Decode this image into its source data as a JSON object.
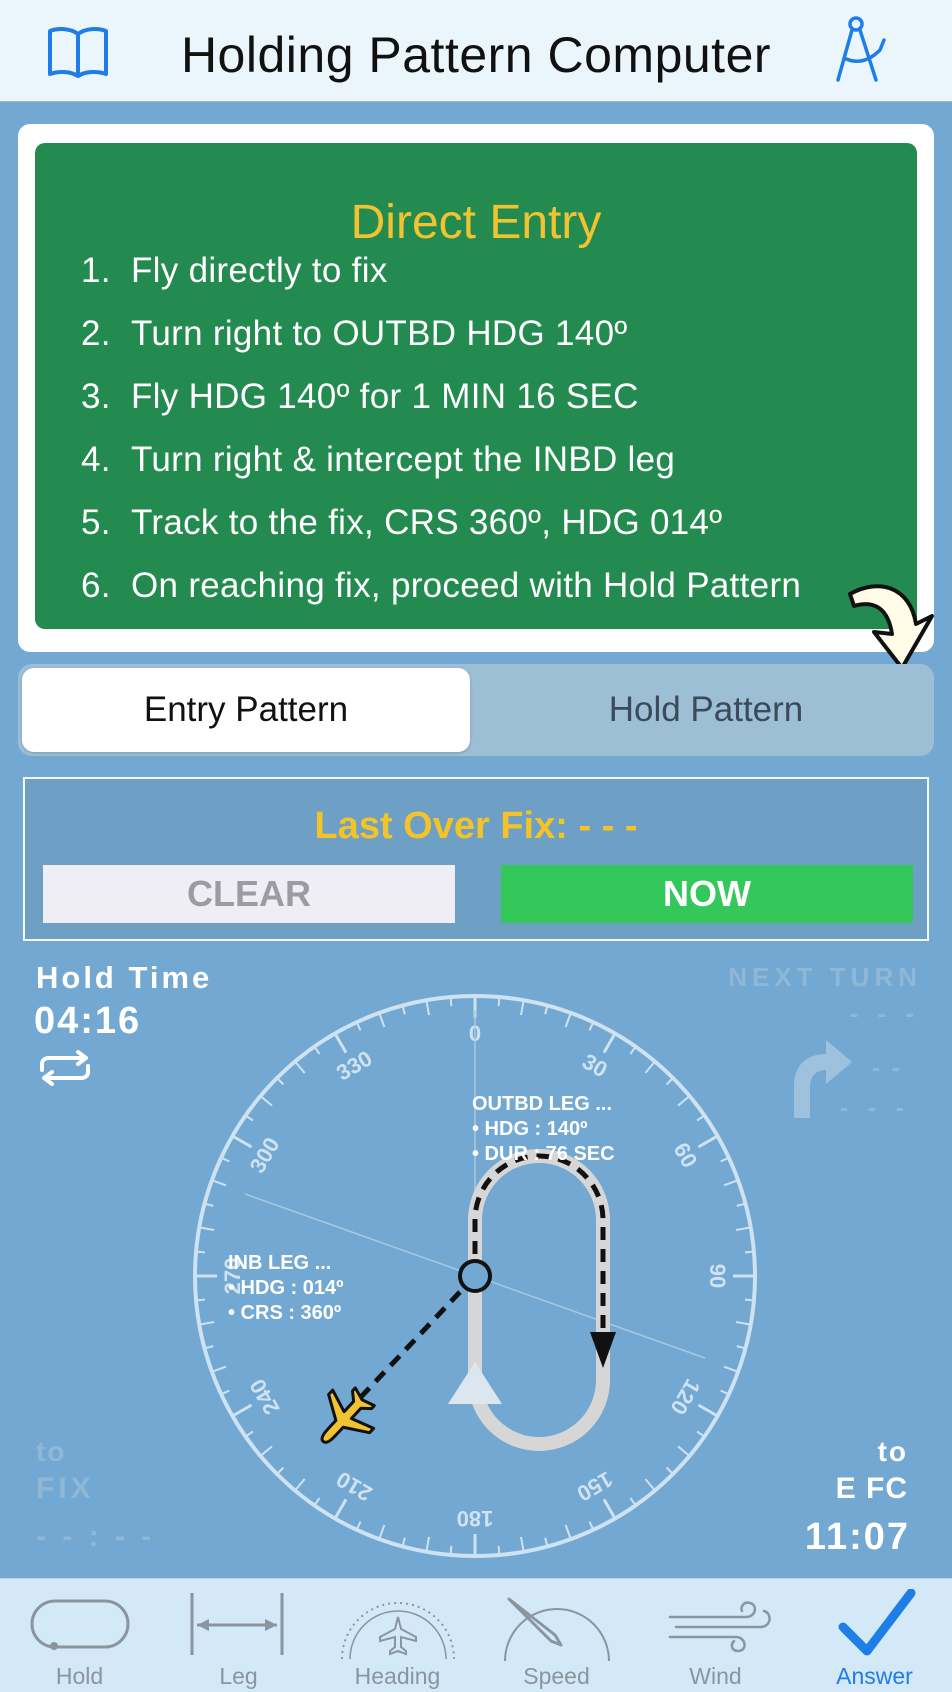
{
  "header": {
    "title": "Holding Pattern Computer",
    "left_icon": "book-icon",
    "right_icon": "compass-icon"
  },
  "instructions": {
    "heading": "Direct Entry",
    "steps": [
      {
        "n": "1.",
        "text": "Fly directly to fix"
      },
      {
        "n": "2.",
        "text": "Turn right to OUTBD HDG 140º"
      },
      {
        "n": "3.",
        "text": "Fly HDG 140º for 1 MIN 16 SEC"
      },
      {
        "n": "4.",
        "text": "Turn right & intercept the INBD leg"
      },
      {
        "n": "5.",
        "text": "Track to the fix, CRS 360º, HDG 014º"
      },
      {
        "n": "6.",
        "text": "On reaching fix, proceed with Hold Pattern"
      }
    ]
  },
  "segment": {
    "options": [
      "Entry Pattern",
      "Hold Pattern"
    ],
    "selected": "Entry Pattern"
  },
  "fix": {
    "label": "Last Over Fix:  - - -",
    "clear_label": "CLEAR",
    "now_label": "NOW"
  },
  "hold_time": {
    "label": "Hold  Time",
    "value": "04:16"
  },
  "next_turn": {
    "label": "NEXT TURN",
    "dash1": "- - -",
    "dash2": "- -",
    "dash3": "- - -"
  },
  "to_fix": {
    "to": "to",
    "label": "FIX",
    "value": "- - : - -"
  },
  "efc": {
    "to": "to",
    "label": "E FC",
    "value": "11:07"
  },
  "dial": {
    "ticks": [
      "0",
      "30",
      "60",
      "90",
      "120",
      "150",
      "180",
      "210",
      "240",
      "270",
      "300",
      "330"
    ],
    "outbound": {
      "title": "OUTBD LEG ...",
      "hdg": "• HDG : 140º",
      "dur": "• DUR : 76 SEC"
    },
    "inbound": {
      "title": "INB LEG ...",
      "hdg": "• HDG : 014º",
      "crs": "• CRS  : 360º"
    }
  },
  "colors": {
    "background": "#72a8d1",
    "green": "#248b50",
    "gold": "#f2c330",
    "now": "#34c759",
    "accent": "#1e7de6"
  },
  "tabs": [
    {
      "label": "Hold",
      "icon": "hold-icon"
    },
    {
      "label": "Leg",
      "icon": "leg-icon"
    },
    {
      "label": "Heading",
      "icon": "heading-icon"
    },
    {
      "label": "Speed",
      "icon": "speed-icon"
    },
    {
      "label": "Wind",
      "icon": "wind-icon"
    },
    {
      "label": "Answer",
      "icon": "checkmark-icon",
      "active": true
    }
  ]
}
